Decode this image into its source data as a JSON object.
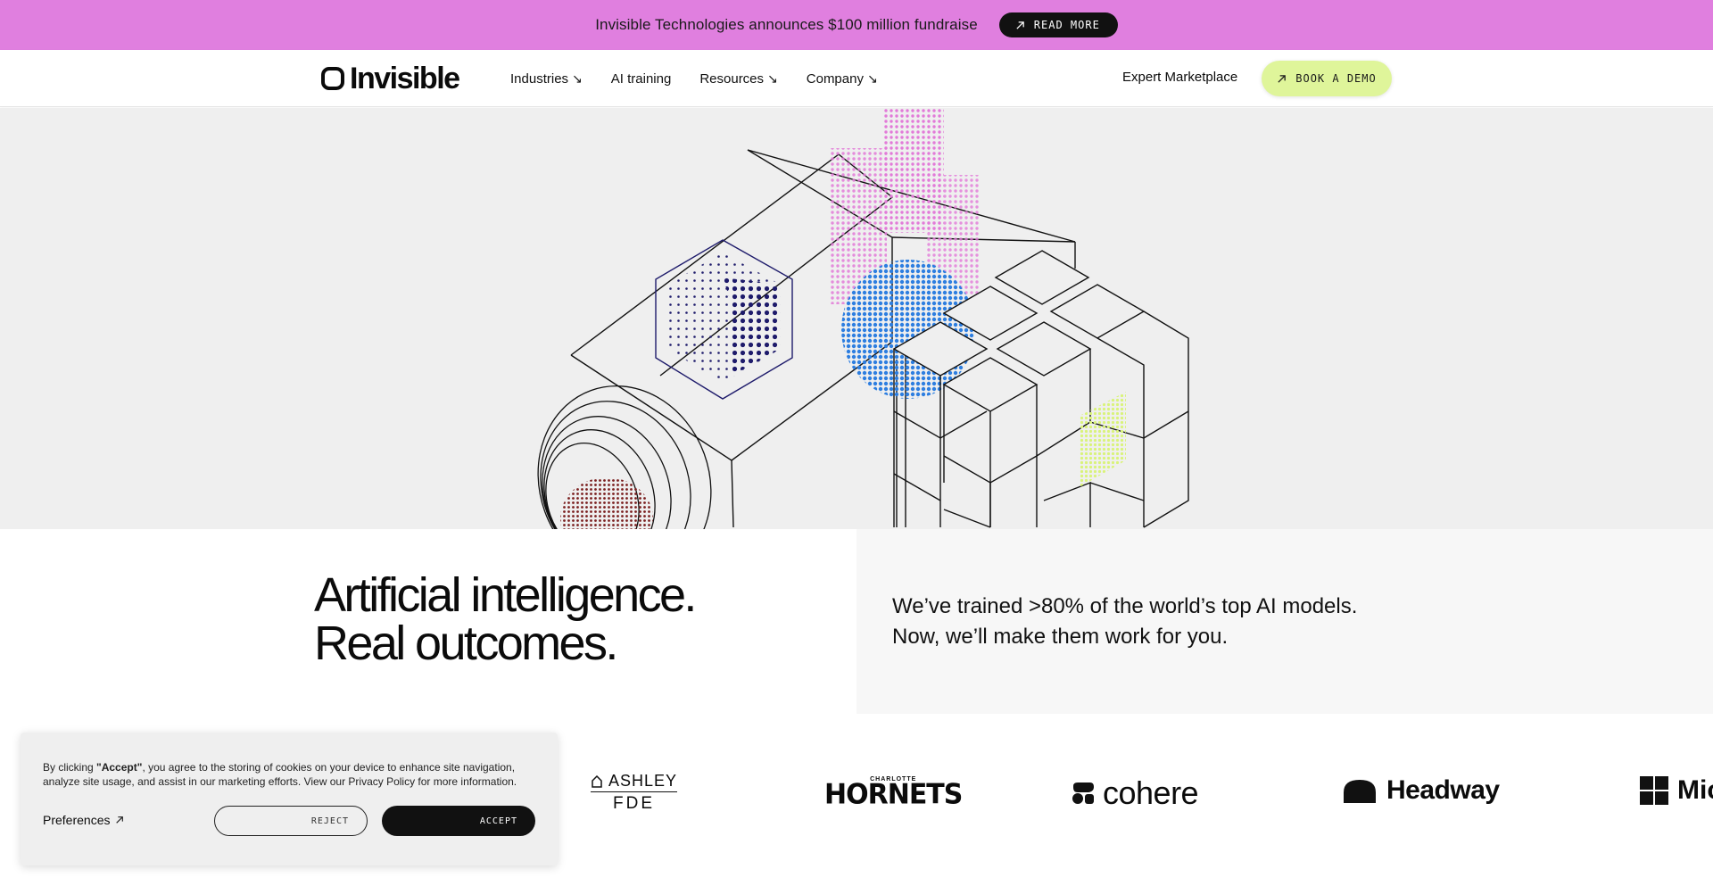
{
  "announcement": {
    "text": "Invisible Technologies announces $100 million fundraise",
    "button_label": "READ MORE"
  },
  "nav": {
    "logo_text": "Invisible",
    "links": [
      {
        "label": "Industries",
        "has_arrow": true
      },
      {
        "label": "AI training",
        "has_arrow": false
      },
      {
        "label": "Resources",
        "has_arrow": true
      },
      {
        "label": "Company",
        "has_arrow": true
      }
    ],
    "arrow_glyph": "↘",
    "expert_label": "Expert Marketplace",
    "cta_label": "BOOK A DEMO"
  },
  "hero": {
    "headline_line1": "Artificial intelligence.",
    "headline_line2": "Real outcomes.",
    "subcopy_line1": "We’ve trained >80% of the world’s top AI models.",
    "subcopy_line2": "Now, we’ll make them work for you."
  },
  "logos": {
    "ashley_top": "ASHLEY",
    "ashley_bottom": "FDE",
    "hornets_small": "CHARLOTTE",
    "hornets_big": "HORNETS",
    "cohere": "cohere",
    "headway": "Headway",
    "micro": "Mic"
  },
  "cookie": {
    "text_prefix": "By clicking ",
    "text_bold": "\"Accept\"",
    "text_suffix": ", you agree to the storing of cookies on your device to enhance site navigation, analyze site usage, and assist in our marketing efforts. View our Privacy Policy for more information.",
    "preferences_label": "Preferences",
    "reject_label": "REJECT",
    "accept_label": "ACCEPT"
  },
  "colors": {
    "announcement_bg": "#e07fdf",
    "cta_bg": "#dff59a",
    "hero_bg": "#efefef",
    "dot_pink": "#e27ad8",
    "dot_blue": "#2d7ee0",
    "dot_navy": "#1e1b6b",
    "dot_lime": "#d9f37a",
    "dot_red": "#7a1d1d"
  },
  "icons": [
    "arrow-up-right-icon",
    "arrow-down-right-icon",
    "invisible-logo-icon",
    "cohere-logo-icon",
    "headway-logo-icon",
    "microsoft-logo-icon",
    "ashley-house-icon"
  ]
}
